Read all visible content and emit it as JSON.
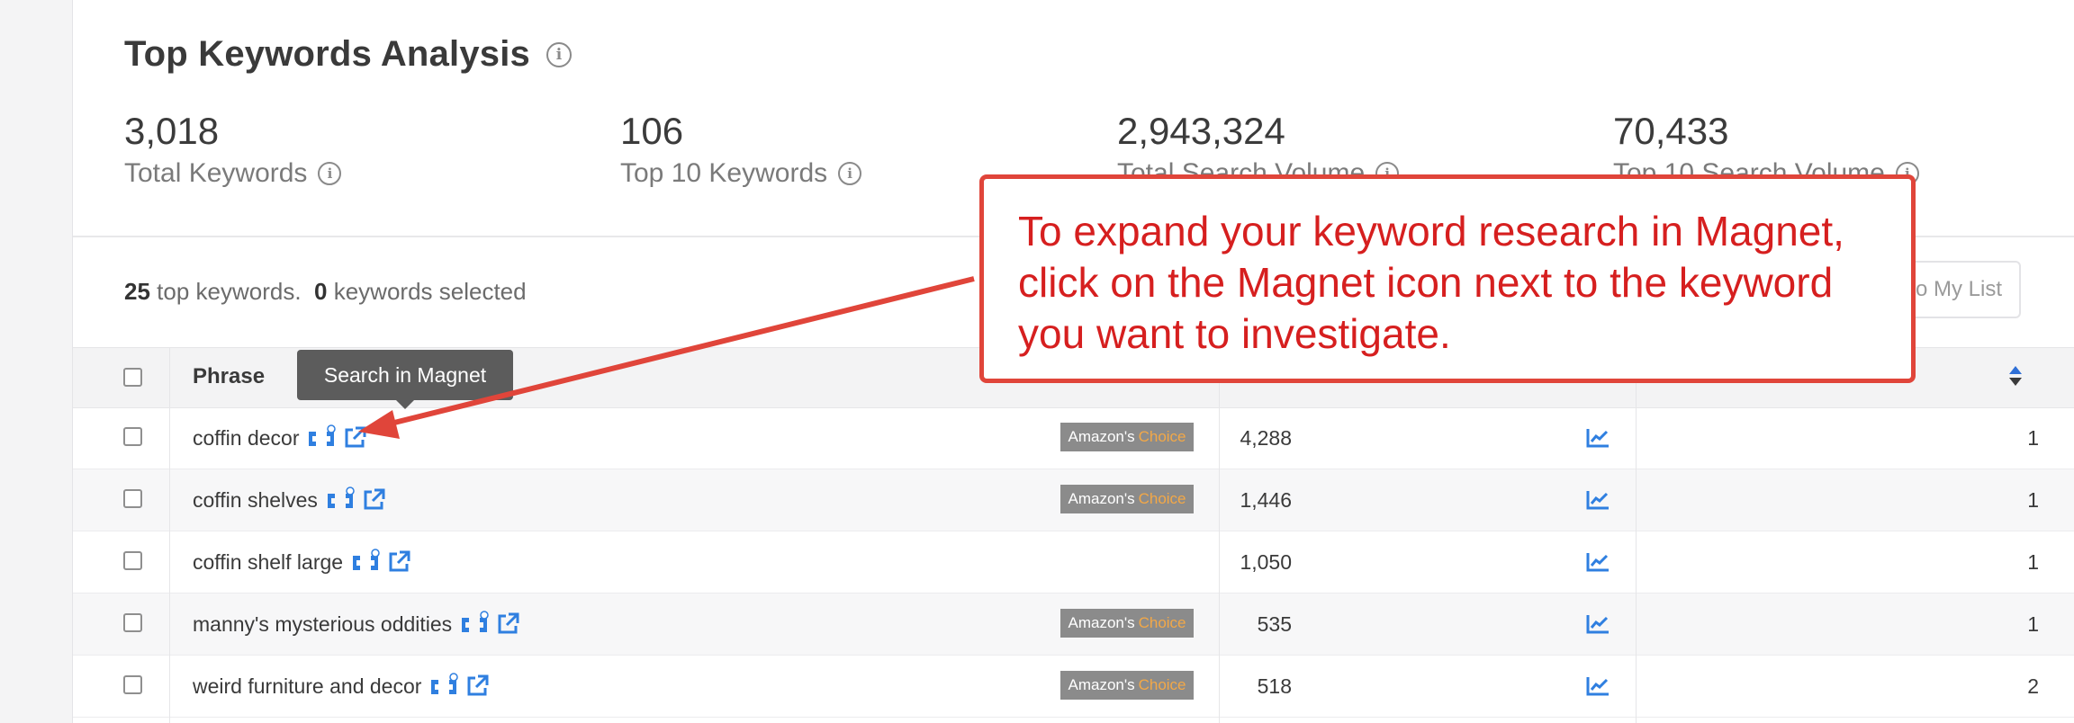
{
  "summary": {
    "title": "Top Keywords Analysis",
    "stats": [
      {
        "value": "3,018",
        "label": "Total Keywords"
      },
      {
        "value": "106",
        "label": "Top 10 Keywords"
      },
      {
        "value": "2,943,324",
        "label": "Total Search Volume"
      },
      {
        "value": "70,433",
        "label": "Top 10 Search Volume"
      }
    ]
  },
  "table": {
    "count_number": "25",
    "count_text": "top keywords.",
    "selected_number": "0",
    "selected_text": "keywords selected",
    "add_button": "Add to My List",
    "header_phrase": "Phrase",
    "badge_amazon": "Amazon's",
    "badge_choice": "Choice",
    "rows": [
      {
        "keyword": "coffin decor",
        "amazons_choice": true,
        "volume": "4,288",
        "rank": "1"
      },
      {
        "keyword": "coffin shelves",
        "amazons_choice": true,
        "volume": "1,446",
        "rank": "1"
      },
      {
        "keyword": "coffin shelf large",
        "amazons_choice": false,
        "volume": "1,050",
        "rank": "1"
      },
      {
        "keyword": "manny's mysterious oddities",
        "amazons_choice": true,
        "volume": "535",
        "rank": "1"
      },
      {
        "keyword": "weird furniture and decor",
        "amazons_choice": true,
        "volume": "518",
        "rank": "2"
      }
    ]
  },
  "tooltip": "Search in Magnet",
  "callout": {
    "line1": "To expand your keyword research in Magnet,",
    "line2": "click on the Magnet icon next to the keyword",
    "line3": "you want to investigate."
  },
  "colors": {
    "accent_blue": "#2f7fe0",
    "callout_red": "#e0453a",
    "badge_gray": "#8b8b8b",
    "choice_orange": "#f3a847"
  },
  "icons": [
    "info-icon",
    "magnet-icon",
    "external-link-icon",
    "trend-chart-icon",
    "sort-icon"
  ]
}
